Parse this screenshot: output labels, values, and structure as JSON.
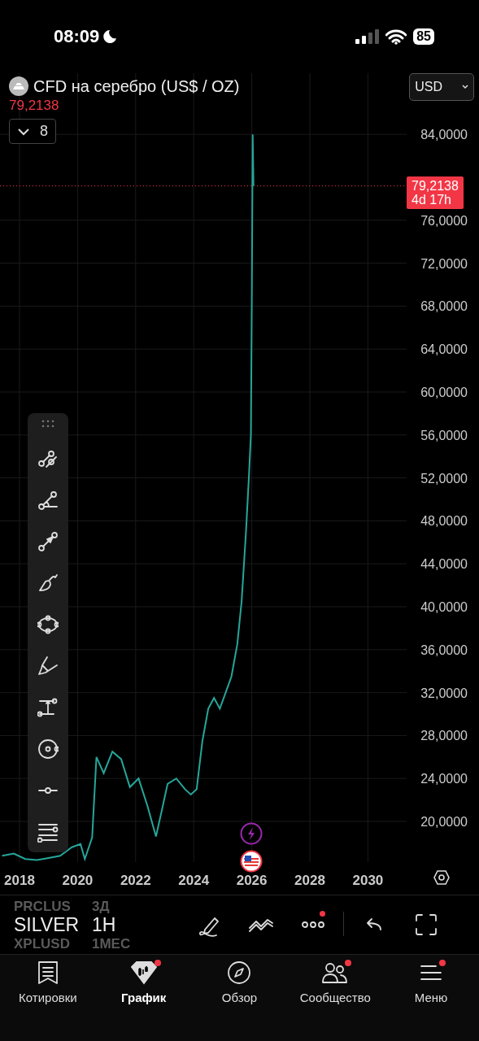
{
  "status_bar": {
    "time": "08:09",
    "battery": "85"
  },
  "symbol": {
    "title": "CFD на серебро (US$ / OZ)",
    "price": "79,2138",
    "indicators_count": "8",
    "currency": "USD"
  },
  "price_tag": {
    "price": "79,2138",
    "countdown": "4d 17h"
  },
  "price_axis": [
    "84,0000",
    "76,0000",
    "72,0000",
    "68,0000",
    "64,0000",
    "60,0000",
    "56,0000",
    "52,0000",
    "48,0000",
    "44,0000",
    "40,0000",
    "36,0000",
    "32,0000",
    "28,0000",
    "24,0000",
    "20,0000"
  ],
  "time_axis": [
    "2018",
    "2020",
    "2022",
    "2024",
    "2026",
    "2028",
    "2030"
  ],
  "picker": {
    "symbols": [
      {
        "label": "PRCLUS",
        "selected": false
      },
      {
        "label": "SILVER",
        "selected": true
      },
      {
        "label": "XPLUSD",
        "selected": false
      }
    ],
    "intervals": [
      {
        "label": "3Д",
        "selected": false
      },
      {
        "label": "1H",
        "selected": true
      },
      {
        "label": "1МЕС",
        "selected": false
      }
    ]
  },
  "toolbar": {
    "more_badge": true
  },
  "nav": [
    {
      "label": "Котировки",
      "selected": false,
      "badge": false
    },
    {
      "label": "График",
      "selected": true,
      "badge": true
    },
    {
      "label": "Обзор",
      "selected": false,
      "badge": false
    },
    {
      "label": "Сообщество",
      "selected": false,
      "badge": true
    },
    {
      "label": "Меню",
      "selected": false,
      "badge": true
    }
  ]
}
